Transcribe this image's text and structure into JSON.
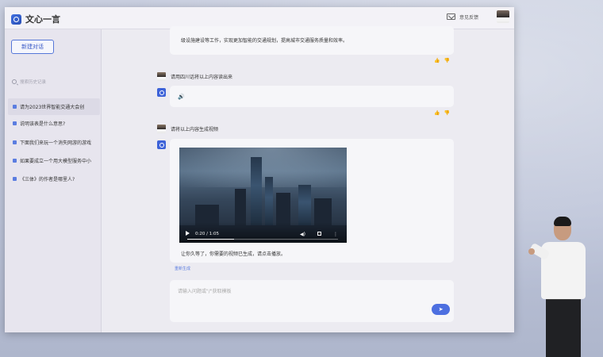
{
  "app": {
    "title": "文心一言"
  },
  "header": {
    "feedback_label": "意见反馈"
  },
  "sidebar": {
    "new_chat_label": "新建对话",
    "search_placeholder": "搜索历史记录",
    "items": [
      {
        "label": "请为2023世界智能交通大会创",
        "active": true
      },
      {
        "label": "说明该表是什么意思?",
        "active": false
      },
      {
        "label": "下面我们来玩一个消失网游的游戏",
        "active": false
      },
      {
        "label": "如果要成立一个用大模型服务中小",
        "active": false
      },
      {
        "label": "《三体》的作者是哪里人?",
        "active": false
      }
    ]
  },
  "chat": {
    "prev_reply_tail": "级设施建设等工作，实现更加智能的交通规划，提高城市交通服务质量和效率。",
    "msg1_user": "请用四川话将以上内容读出来",
    "msg2_user": "请将以上内容生成视频",
    "video": {
      "time": "0:20 / 1:05",
      "progress": 0.31
    },
    "video_caption": "让你久等了，你需要的视频已生成，请点击播放。",
    "regenerate_label": "重新生成",
    "input_placeholder": "请输入问题或\"/\"获取模板"
  },
  "colors": {
    "accent": "#4d6fe0"
  }
}
